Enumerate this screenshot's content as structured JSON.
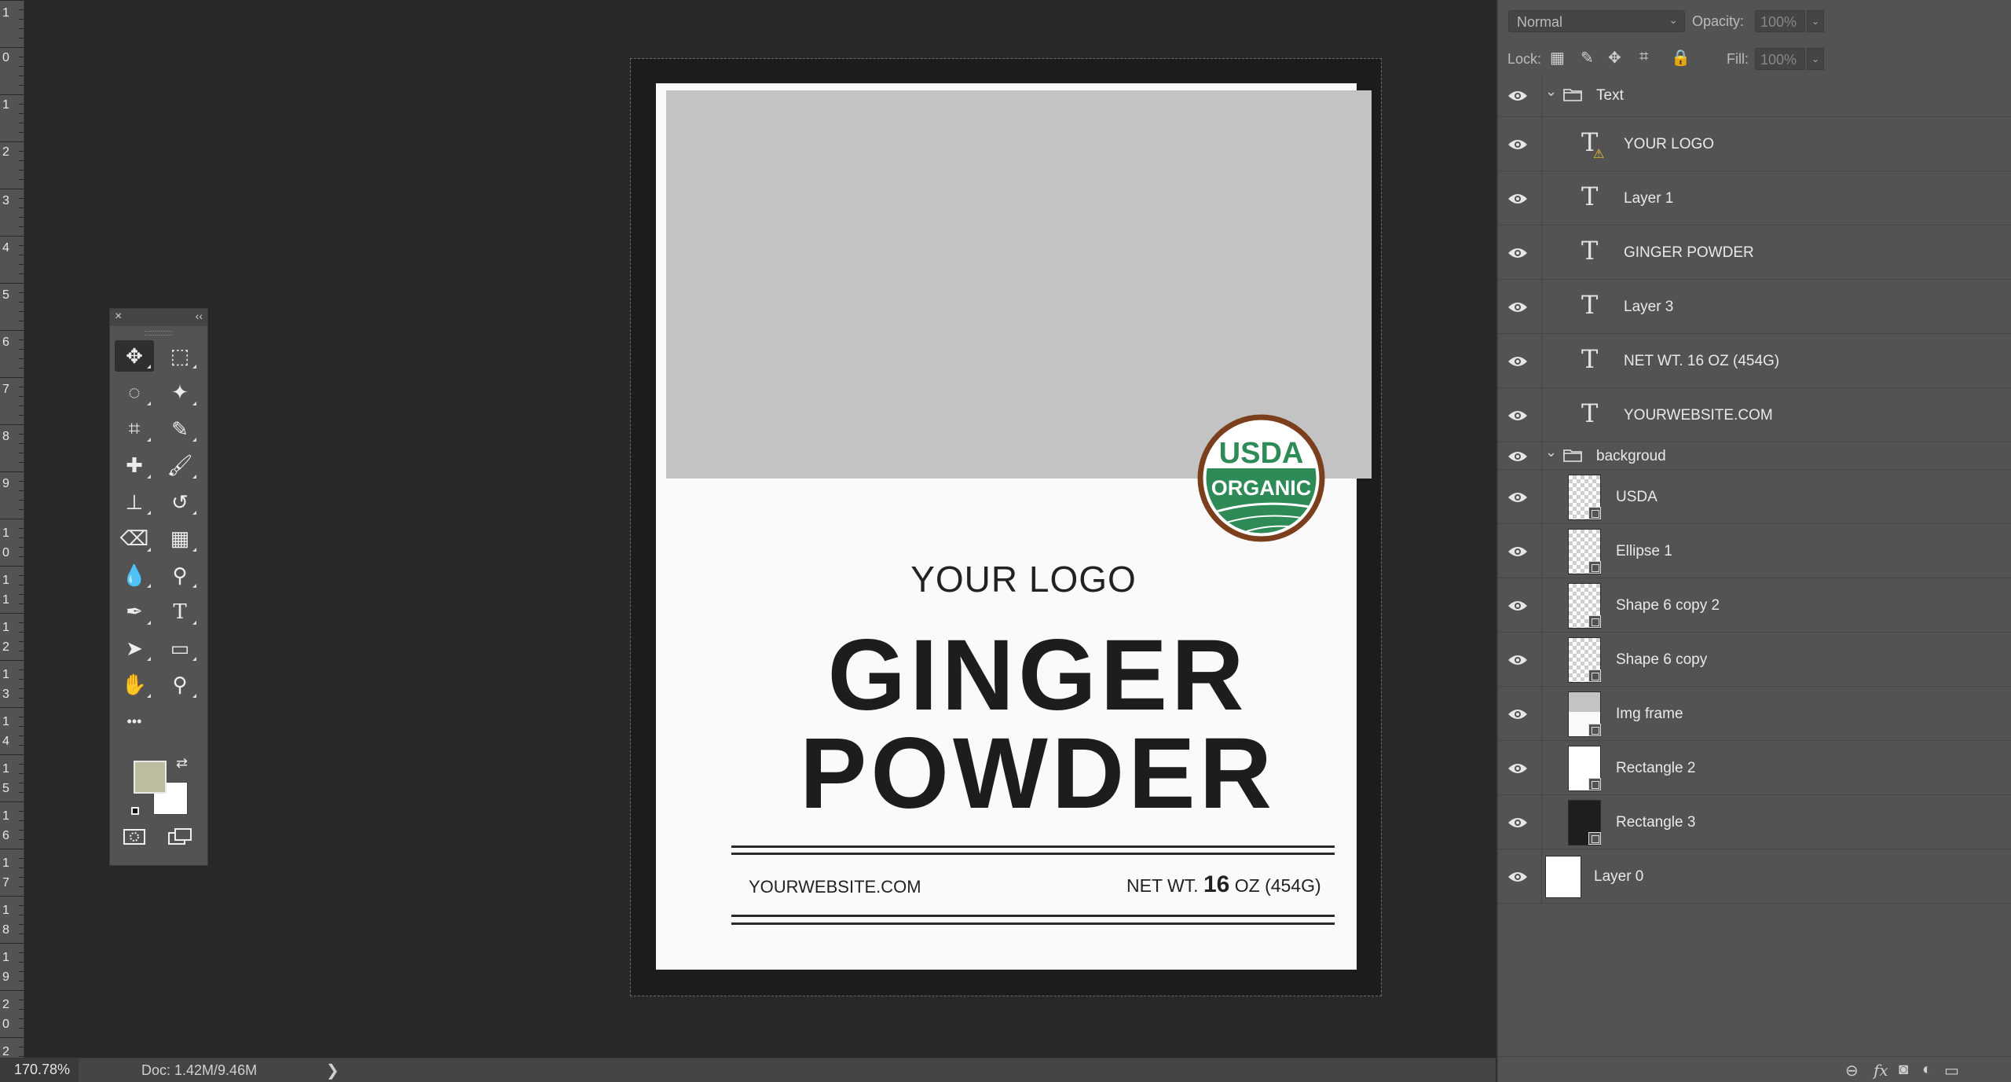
{
  "ruler": {
    "labels": [
      "1",
      "0",
      "1",
      "2",
      "3",
      "4",
      "5",
      "6",
      "7",
      "8",
      "9",
      "1",
      "0",
      "1",
      "1",
      "1",
      "2",
      "1",
      "3",
      "1",
      "4",
      "1",
      "5",
      "1",
      "6",
      "1",
      "7",
      "1",
      "8",
      "1",
      "9",
      "2",
      "0",
      "2"
    ]
  },
  "document": {
    "logo_text": "YOUR LOGO",
    "title_line1": "GINGER",
    "title_line2": "POWDER",
    "website": "YOURWEBSITE.COM",
    "net_prefix": "NET WT.",
    "net_number": "16",
    "net_suffix": "OZ (454G)",
    "seal_top": "USDA",
    "seal_bottom": "ORGANIC",
    "seal_green": "#2e8b57",
    "seal_ring": "#7b3f1d"
  },
  "tools_panel": {
    "close": "×",
    "collapse": "‹‹",
    "tools": [
      {
        "name": "move-tool",
        "glyph": "✥"
      },
      {
        "name": "rectangular-marquee-tool",
        "glyph": "⬚"
      },
      {
        "name": "lasso-tool",
        "glyph": "◌"
      },
      {
        "name": "magic-wand-tool",
        "glyph": "✦"
      },
      {
        "name": "crop-tool",
        "glyph": "⌗"
      },
      {
        "name": "eyedropper-tool",
        "glyph": "✎"
      },
      {
        "name": "healing-brush-tool",
        "glyph": "✚"
      },
      {
        "name": "brush-tool",
        "glyph": "🖌"
      },
      {
        "name": "clone-stamp-tool",
        "glyph": "⊥"
      },
      {
        "name": "history-brush-tool",
        "glyph": "↺"
      },
      {
        "name": "eraser-tool",
        "glyph": "⌫"
      },
      {
        "name": "gradient-tool",
        "glyph": "▦"
      },
      {
        "name": "blur-tool",
        "glyph": "💧"
      },
      {
        "name": "dodge-tool",
        "glyph": "⚲"
      },
      {
        "name": "pen-tool",
        "glyph": "✒"
      },
      {
        "name": "type-tool",
        "glyph": "T"
      },
      {
        "name": "path-selection-tool",
        "glyph": "➤"
      },
      {
        "name": "rectangle-tool",
        "glyph": "▭"
      },
      {
        "name": "hand-tool",
        "glyph": "✋"
      },
      {
        "name": "zoom-tool",
        "glyph": "⚲"
      },
      {
        "name": "more-tools",
        "glyph": "•••"
      }
    ],
    "foreground_color": "#bdbc9e",
    "background_color": "#ffffff"
  },
  "layers_panel": {
    "blend_mode": "Normal",
    "opacity_label": "Opacity:",
    "opacity_value": "100%",
    "lock_label": "Lock:",
    "fill_label": "Fill:",
    "fill_value": "100%",
    "layers": [
      {
        "name": "Text",
        "kind": "group"
      },
      {
        "name": "YOUR LOGO",
        "kind": "text",
        "warning": true
      },
      {
        "name": "Layer 1",
        "kind": "text"
      },
      {
        "name": "GINGER POWDER",
        "kind": "text"
      },
      {
        "name": "Layer 3",
        "kind": "text"
      },
      {
        "name": "NET WT. 16 OZ (454G)",
        "kind": "text"
      },
      {
        "name": "YOURWEBSITE.COM",
        "kind": "text"
      },
      {
        "name": "backgroud",
        "kind": "group"
      },
      {
        "name": "USDA",
        "kind": "smart"
      },
      {
        "name": "Ellipse 1",
        "kind": "shape"
      },
      {
        "name": "Shape 6 copy 2",
        "kind": "shape"
      },
      {
        "name": "Shape 6 copy",
        "kind": "shape"
      },
      {
        "name": "Img frame",
        "kind": "shape"
      },
      {
        "name": "Rectangle 2",
        "kind": "shape"
      },
      {
        "name": "Rectangle 3",
        "kind": "shape"
      },
      {
        "name": "Layer 0",
        "kind": "pixel"
      }
    ]
  },
  "statusbar": {
    "zoom": "170.78%",
    "doc_info": "Doc: 1.42M/9.46M",
    "arrow": "❯"
  }
}
